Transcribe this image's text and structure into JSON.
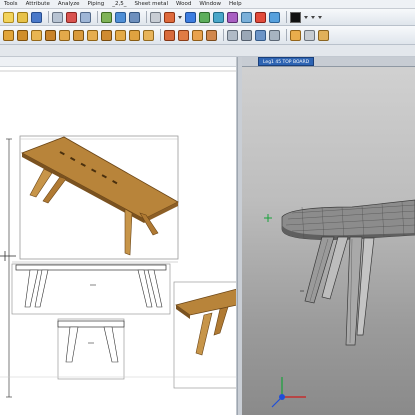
{
  "menu": {
    "items": [
      "Tools",
      "Attribute",
      "Analyze",
      "Piping",
      "_2,5_",
      "Sheet metal",
      "Wood",
      "Window",
      "Help"
    ]
  },
  "toolbar1": {
    "icons": [
      "new-icon",
      "open-icon",
      "save-icon",
      "print-icon",
      "cut-icon",
      "copy-icon",
      "paste-icon",
      "undo-icon",
      "redo-icon",
      "select-icon",
      "layer-icon",
      "measure-icon",
      "zoom-icon",
      "pan-icon",
      "rotate-icon",
      "render-icon",
      "part-icon",
      "assembly-icon",
      "view-icon"
    ]
  },
  "toolbar2": {
    "icons": [
      "board-icon",
      "edge-icon",
      "drill-icon",
      "groove-icon",
      "joint-icon",
      "dowel-icon",
      "hinge-icon",
      "handle-icon",
      "leg-icon",
      "panel-icon",
      "cabinet-icon",
      "list-icon",
      "cutlist-icon",
      "material-icon",
      "color-icon",
      "texture-icon",
      "sheet-icon",
      "dimension-icon",
      "label-icon",
      "export-icon"
    ]
  },
  "model_view": {
    "tab_label": "Leg1 45 TOP BOARD"
  },
  "colors": {
    "wood": "#b8843a",
    "wood_dark": "#7a5220",
    "accent_tab": "#2e64b3",
    "axis_x": "#d01c1c",
    "axis_y": "#17a33a",
    "axis_z": "#1f4fd8"
  }
}
